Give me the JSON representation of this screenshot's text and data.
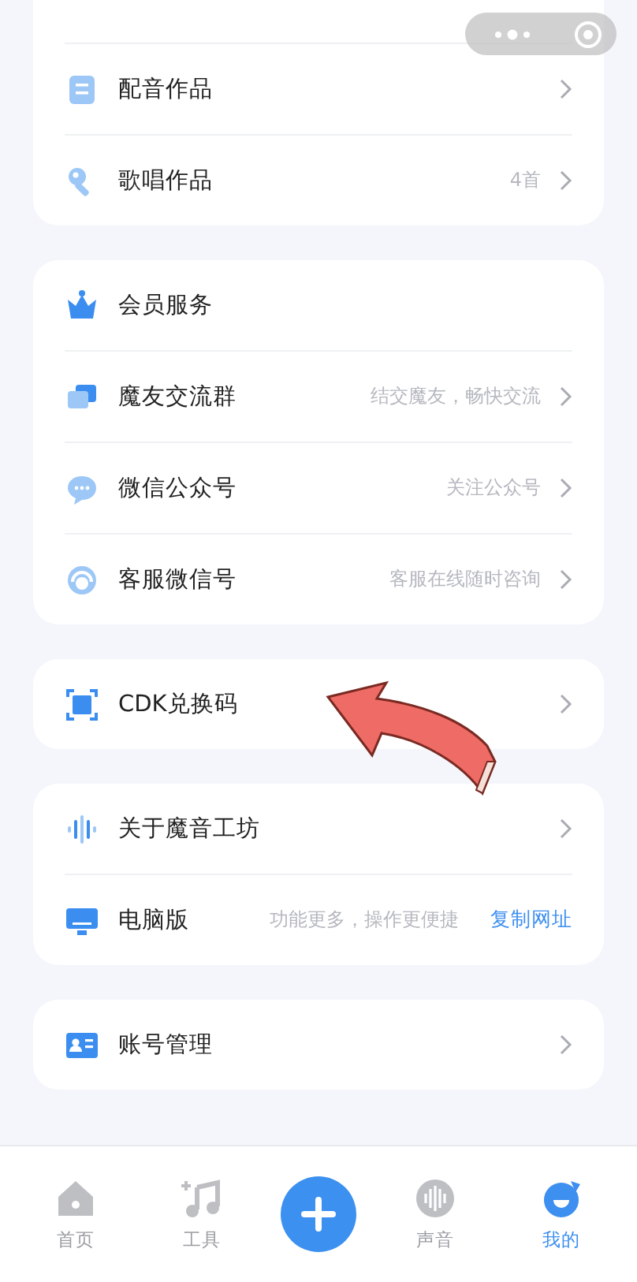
{
  "sections": [
    {
      "rows": [
        {
          "kind": "item",
          "label": "配音作品"
        },
        {
          "kind": "item",
          "label": "歌唱作品",
          "hint": "4首"
        }
      ]
    },
    {
      "rows": [
        {
          "kind": "header",
          "label": "会员服务"
        },
        {
          "kind": "item",
          "label": "魔友交流群",
          "hint": "结交魔友，畅快交流"
        },
        {
          "kind": "item",
          "label": "微信公众号",
          "hint": "关注公众号"
        },
        {
          "kind": "item",
          "label": "客服微信号",
          "hint": "客服在线随时咨询"
        }
      ]
    },
    {
      "rows": [
        {
          "kind": "item",
          "label": "CDK兑换码"
        }
      ]
    },
    {
      "rows": [
        {
          "kind": "item",
          "label": "关于魔音工坊"
        },
        {
          "kind": "link",
          "label": "电脑版",
          "hint": "功能更多，操作更便捷",
          "link": "复制网址"
        }
      ]
    },
    {
      "rows": [
        {
          "kind": "item",
          "label": "账号管理"
        }
      ]
    }
  ],
  "tabs": [
    {
      "kind": "tab",
      "label": "首页",
      "selected": false
    },
    {
      "kind": "tab",
      "label": "工具",
      "selected": false
    },
    {
      "kind": "action",
      "selected": false
    },
    {
      "kind": "tab",
      "label": "声音",
      "selected": false
    },
    {
      "kind": "tab",
      "label": "我的",
      "selected": true
    }
  ]
}
